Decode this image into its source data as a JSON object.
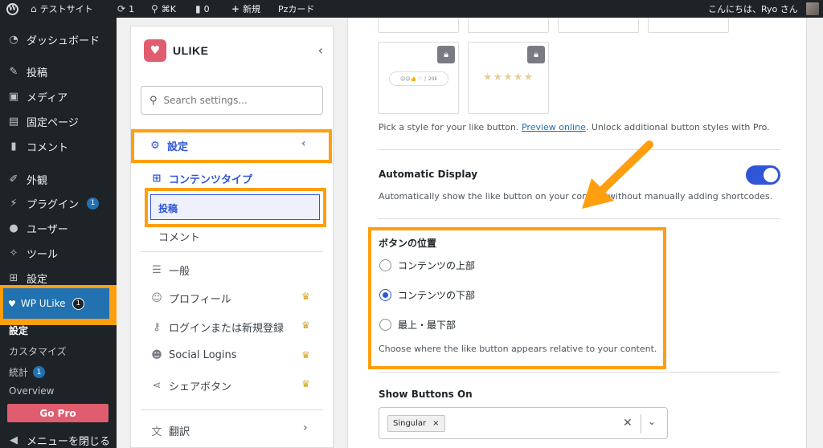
{
  "adminbar": {
    "wp_logo": "W",
    "site_icon": "home-icon",
    "site_name": "テストサイト",
    "updates_count": "1",
    "search_shortcut": "⌘K",
    "comments_count": "0",
    "new_label": "新規",
    "pz_label": "Pzカード",
    "greeting": "こんにちは、Ryo さん"
  },
  "wp_sidebar": {
    "items": [
      {
        "label": "ダッシュボード",
        "icon": "dashboard-icon"
      },
      {
        "label": "投稿",
        "icon": "pin-icon"
      },
      {
        "label": "メディア",
        "icon": "media-icon"
      },
      {
        "label": "固定ページ",
        "icon": "page-icon"
      },
      {
        "label": "コメント",
        "icon": "comment-icon"
      },
      {
        "label": "外観",
        "icon": "appearance-icon"
      },
      {
        "label": "プラグイン",
        "icon": "plugin-icon",
        "badge": "1"
      },
      {
        "label": "ユーザー",
        "icon": "user-icon"
      },
      {
        "label": "ツール",
        "icon": "wrench-icon"
      },
      {
        "label": "設定",
        "icon": "settings-icon"
      }
    ],
    "wp_ulike": {
      "label": "WP ULike",
      "badge": "1"
    },
    "sub_items": [
      "設定",
      "カスタマイズ",
      "統計",
      "Overview"
    ],
    "stats_badge": "1",
    "go_pro": "Go Pro",
    "collapse_menu": "メニューを閉じる"
  },
  "ulike_panel": {
    "brand": "ULIKE",
    "search_placeholder": "Search settings...",
    "nav_settings": "設定",
    "nav_content_types": "コンテンツタイプ",
    "nav_posts": "投稿",
    "nav_comments": "コメント",
    "nav_general": "一般",
    "nav_profile": "プロフィール",
    "nav_login": "ログインまたは新規登録",
    "nav_social": "Social Logins",
    "nav_share": "シェアボタン",
    "nav_translate": "翻訳"
  },
  "main": {
    "emoji_count": "20k",
    "style_desc_pre": "Pick a style for your like button. ",
    "style_desc_link": "Preview online",
    "style_desc_post": ". Unlock additional button styles with Pro.",
    "auto_display_title": "Automatic Display",
    "auto_display_desc": "Automatically show the like button on your content without manually adding shortcodes.",
    "auto_display_on": true,
    "position_title": "ボタンの位置",
    "position_options": [
      "コンテンツの上部",
      "コンテンツの下部",
      "最上・最下部"
    ],
    "position_selected": "コンテンツの下部",
    "position_desc": "Choose where the like button appears relative to your content.",
    "show_buttons_title": "Show Buttons On",
    "show_buttons_tag": "Singular"
  },
  "colors": {
    "highlight": "#ff9e0f",
    "accent": "#2f56d6",
    "wp_dark": "#1d2327",
    "go_pro": "#e05d6f"
  }
}
